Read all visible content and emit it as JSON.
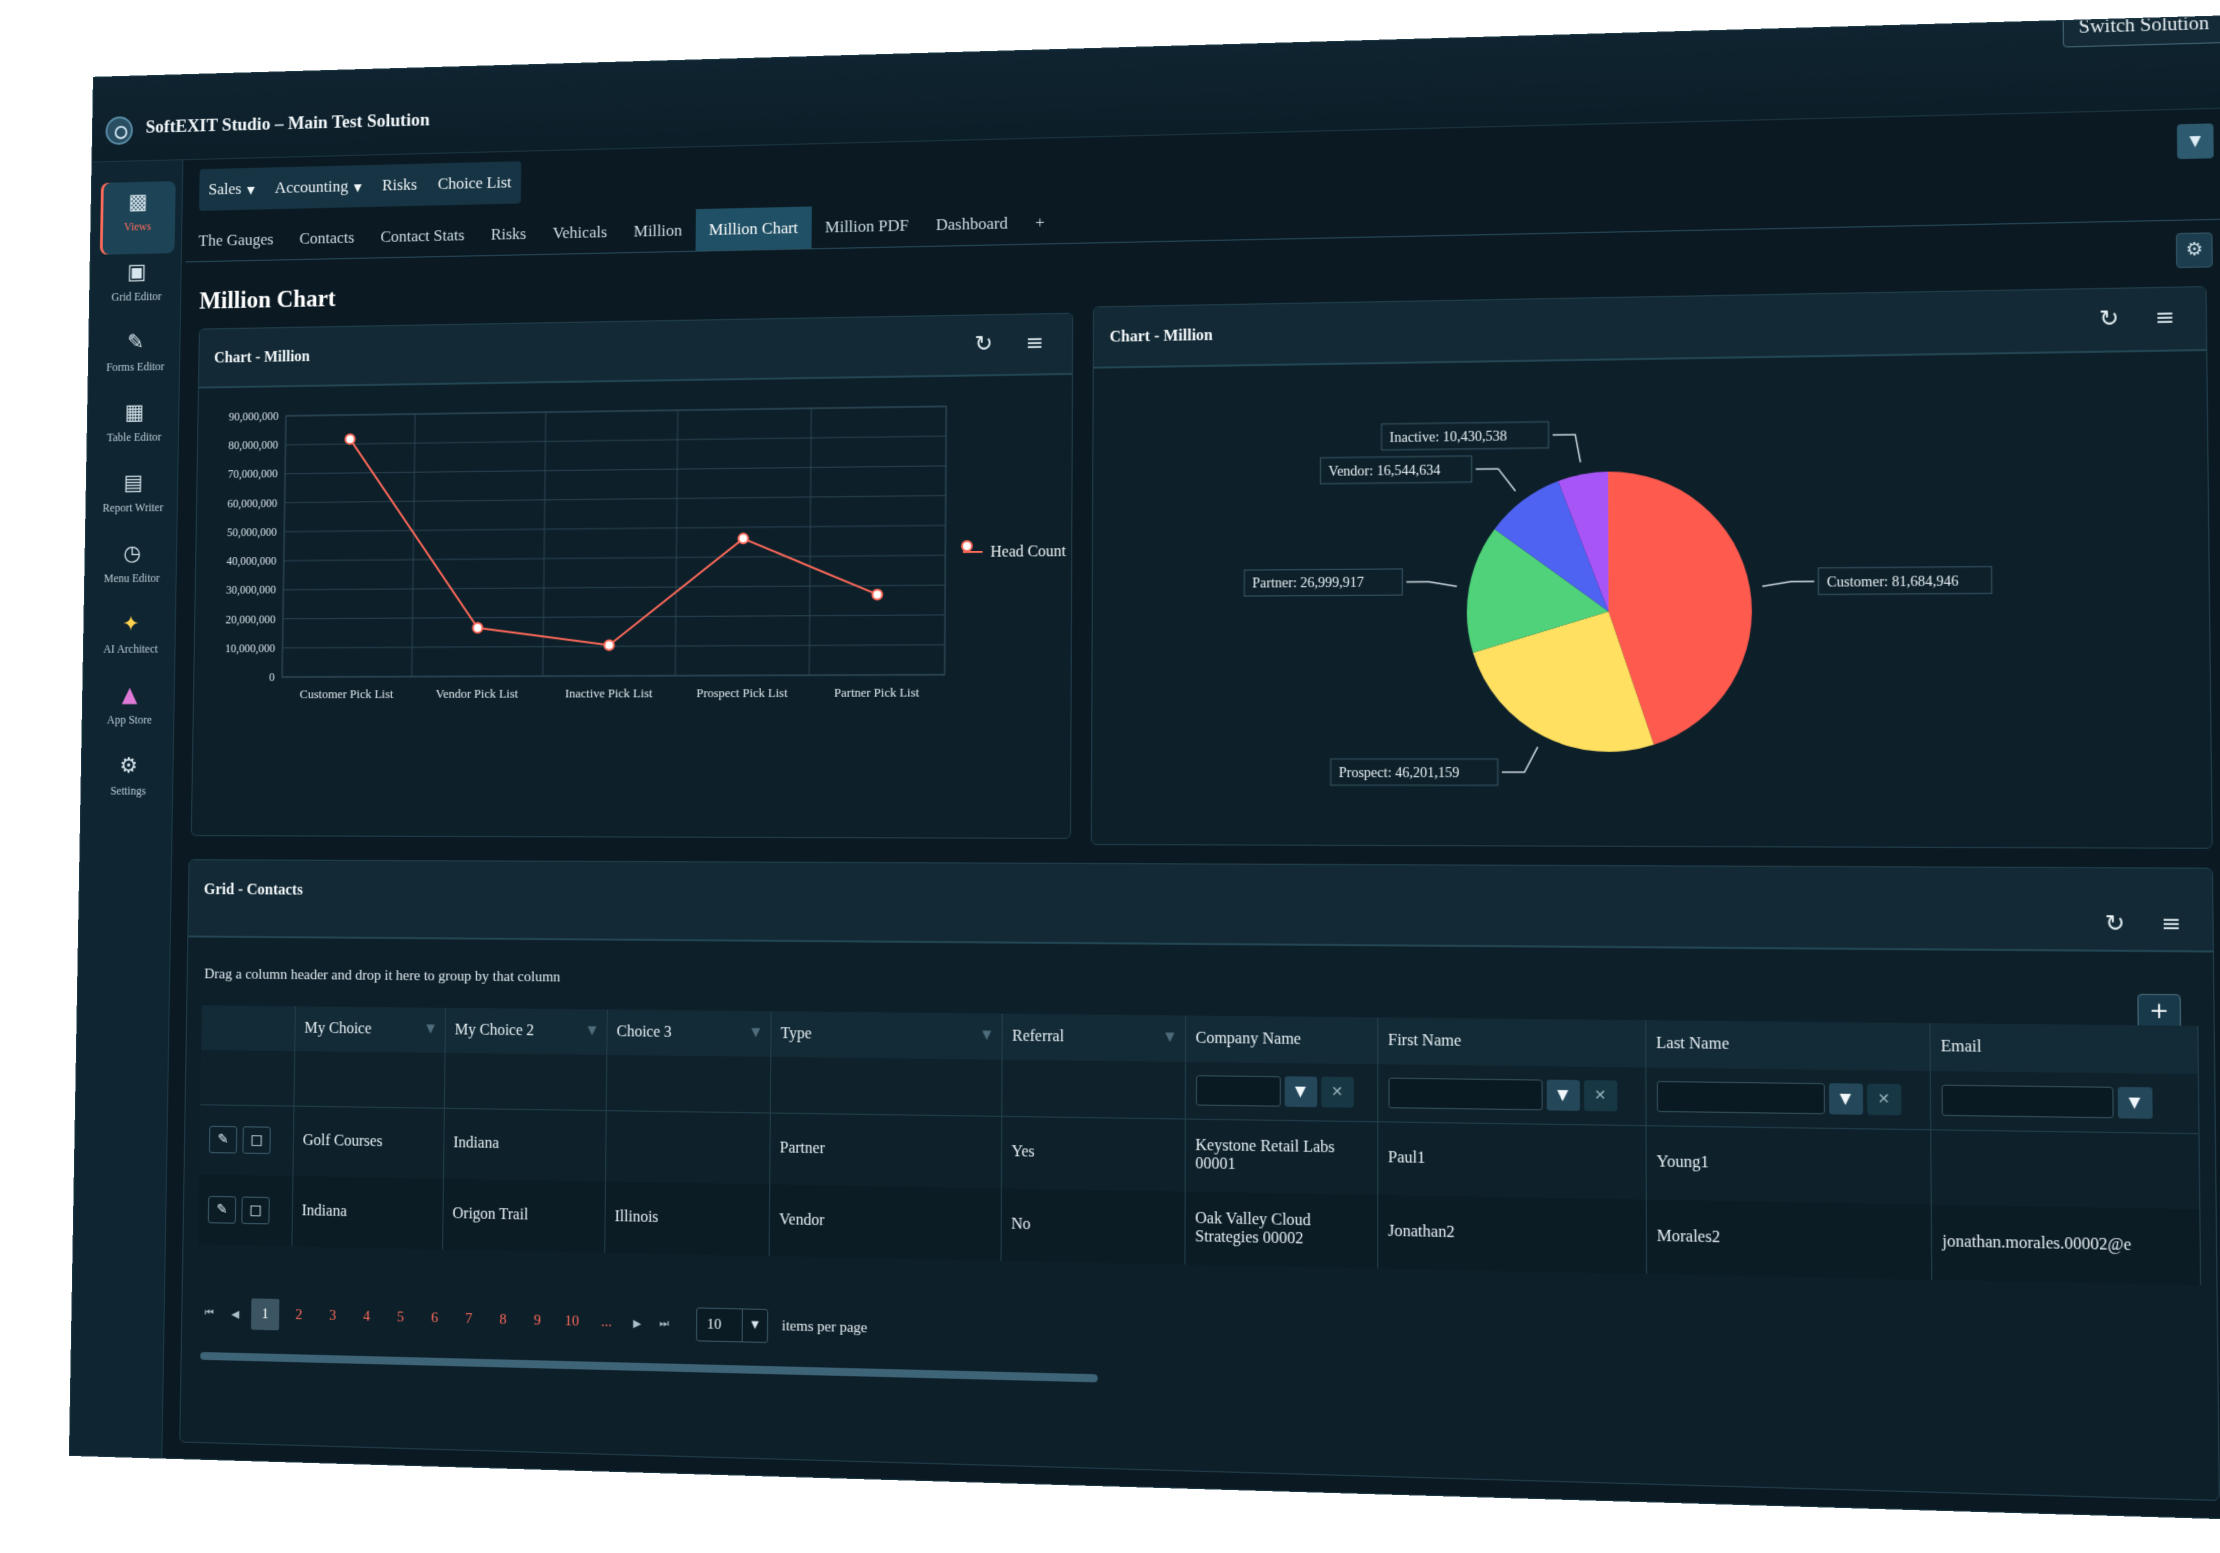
{
  "header": {
    "title": "SoftEXIT Studio – Main Test Solution",
    "switch_label": "Switch Solution"
  },
  "sidebar": {
    "items": [
      {
        "label": "Views",
        "icon": "bar-chart-icon"
      },
      {
        "label": "Grid Editor",
        "icon": "monitor-icon"
      },
      {
        "label": "Forms Editor",
        "icon": "memo-icon"
      },
      {
        "label": "Table Editor",
        "icon": "floppy-disk-icon"
      },
      {
        "label": "Report Writer",
        "icon": "document-icon"
      },
      {
        "label": "Menu Editor",
        "icon": "stopwatch-icon"
      },
      {
        "label": "AI Architect",
        "icon": "sparkles-icon"
      },
      {
        "label": "App Store",
        "icon": "shopping-bag-icon"
      },
      {
        "label": "Settings",
        "icon": "gear-icon"
      }
    ]
  },
  "menubar": {
    "items": [
      "Sales",
      "Accounting",
      "Risks",
      "Choice List"
    ]
  },
  "tabs": {
    "items": [
      "The Gauges",
      "Contacts",
      "Contact Stats",
      "Risks",
      "Vehicals",
      "Million",
      "Million Chart",
      "Million PDF",
      "Dashboard",
      "+"
    ],
    "active": "Million Chart"
  },
  "page": {
    "title": "Million Chart"
  },
  "line_panel": {
    "title": "Chart - Million"
  },
  "pie_panel": {
    "title": "Chart - Million"
  },
  "chart_data": [
    {
      "type": "line",
      "title": "",
      "categories": [
        "Customer Pick List",
        "Vendor Pick List",
        "Inactive Pick List",
        "Prospect Pick List",
        "Partner Pick List"
      ],
      "series": [
        {
          "name": "Head Count",
          "values": [
            81684946,
            16544634,
            10430538,
            46201159,
            26999917
          ],
          "color": "#ff6a5a"
        }
      ],
      "y_ticks": [
        "0",
        "10,000,000",
        "20,000,000",
        "30,000,000",
        "40,000,000",
        "50,000,000",
        "60,000,000",
        "70,000,000",
        "80,000,000",
        "90,000,000"
      ],
      "ylim": [
        0,
        90000000
      ],
      "grid": true,
      "legend": "right"
    },
    {
      "type": "pie",
      "title": "",
      "slices": [
        {
          "label": "Customer: 81,684,946",
          "value": 81684946,
          "color": "#ff5a4e"
        },
        {
          "label": "Prospect: 46,201,159",
          "value": 46201159,
          "color": "#ffe060"
        },
        {
          "label": "Partner: 26,999,917",
          "value": 26999917,
          "color": "#4fd27a"
        },
        {
          "label": "Vendor: 16,544,634",
          "value": 16544634,
          "color": "#4f63f2"
        },
        {
          "label": "Inactive: 10,430,538",
          "value": 10430538,
          "color": "#a855f7"
        }
      ]
    }
  ],
  "grid": {
    "title": "Grid - Contacts",
    "group_hint": "Drag a column header and drop it here to group by that column",
    "columns": [
      "My Choice",
      "My Choice 2",
      "Choice 3",
      "Type",
      "Referral",
      "Company Name",
      "First Name",
      "Last Name",
      "Email"
    ],
    "rows": [
      [
        "Golf Courses",
        "Indiana",
        "",
        "Partner",
        "Yes",
        "Keystone Retail Labs 00001",
        "Paul1",
        "Young1",
        ""
      ],
      [
        "Indiana",
        "Origon Trail",
        "Illinois",
        "Vendor",
        "No",
        "Oak Valley Cloud Strategies 00002",
        "Jonathan2",
        "Morales2",
        "jonathan.morales.00002@e"
      ]
    ],
    "pager": {
      "pages": [
        "1",
        "2",
        "3",
        "4",
        "5",
        "6",
        "7",
        "8",
        "9",
        "10",
        "..."
      ],
      "current": "1",
      "page_size": "10",
      "per_page_label": "items per page"
    }
  },
  "colors": {
    "accent": "#ff6a5a",
    "background": "#0b1a22",
    "panel": "#0d1f29"
  }
}
